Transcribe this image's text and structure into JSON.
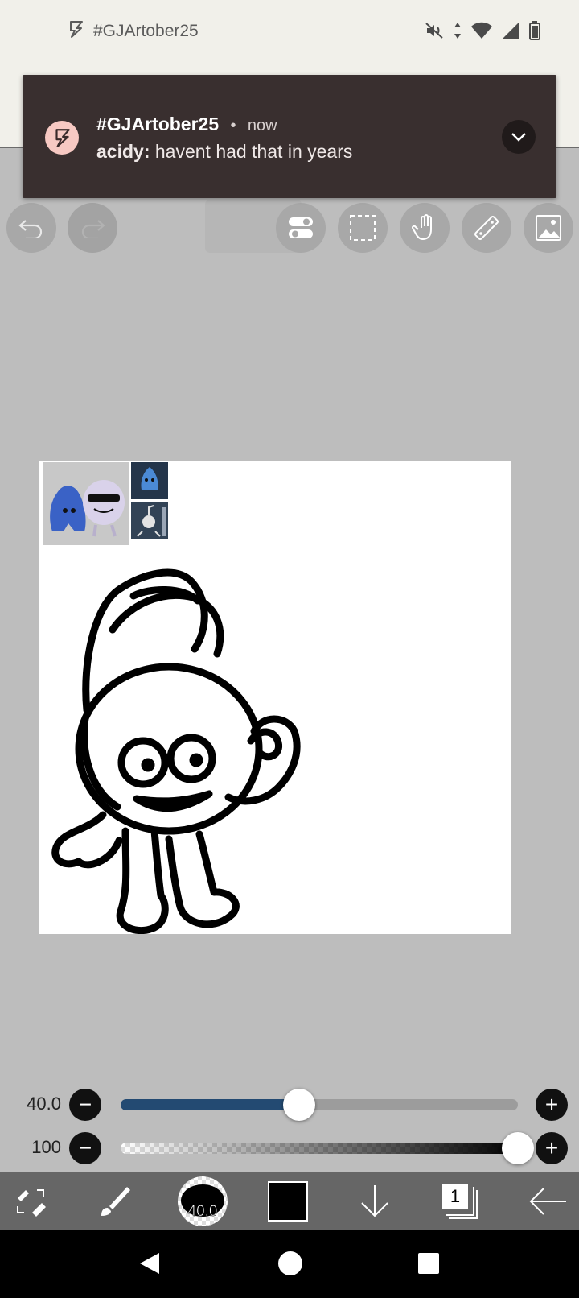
{
  "status_bar": {
    "app_label": "#GJArtober25",
    "icons": [
      "app-bolt-icon",
      "mute-icon",
      "data-arrows-icon",
      "wifi-icon",
      "signal-icon",
      "battery-icon"
    ]
  },
  "notification": {
    "title": "#GJArtober25",
    "separator": "•",
    "time": "now",
    "sender": "acidy:",
    "message": "havent had that in years",
    "icon": "bolt-icon",
    "accent": "#f7c9c3",
    "background": "#392f2f"
  },
  "toolbar": {
    "buttons": [
      "undo-icon",
      "redo-icon",
      "toggle-icon",
      "selection-icon",
      "hand-icon",
      "ruler-icon",
      "image-icon"
    ]
  },
  "canvas": {
    "background": "#ffffff"
  },
  "sliders": {
    "size": {
      "value_label": "40.0",
      "value_fraction": 0.45,
      "accent": "#234a72"
    },
    "opacity": {
      "value_label": "100",
      "value_fraction": 1.0
    }
  },
  "bottom_toolbar": {
    "brush_size_label": "40.0",
    "color": "#000000",
    "layer_count": "1",
    "icons": [
      "swap-tools-icon",
      "brush-icon",
      "brush-size-icon",
      "color-swatch-icon",
      "down-arrow-icon",
      "layers-icon",
      "back-arrow-icon"
    ]
  },
  "nav_bar": {
    "icons": [
      "nav-back-icon",
      "nav-home-icon",
      "nav-recents-icon"
    ]
  }
}
